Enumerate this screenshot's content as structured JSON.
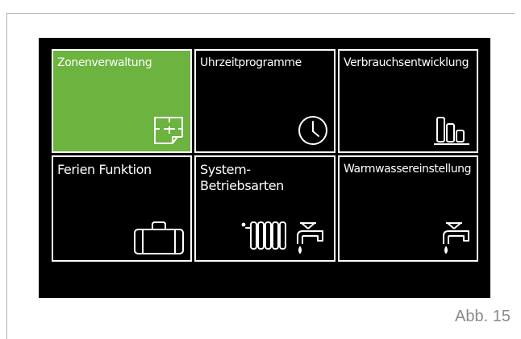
{
  "tiles": [
    {
      "label": "Zonenverwaltung",
      "icon": "floor-plan-icon",
      "selected": true
    },
    {
      "label": "Uhrzeitprogramme",
      "icon": "clock-icon",
      "selected": false
    },
    {
      "label": "Verbrauchsentwicklung",
      "icon": "bar-chart-icon",
      "selected": false
    },
    {
      "label": "Ferien Funktion",
      "icon": "suitcase-icon",
      "selected": false
    },
    {
      "label": "System-\nBetriebsarten",
      "label_line1": "System-",
      "label_line2": "Betriebsarten",
      "icons": [
        "radiator-icon",
        "faucet-icon"
      ],
      "selected": false
    },
    {
      "label": "Warmwassereinstellung",
      "icon": "faucet-icon",
      "selected": false
    }
  ],
  "caption": "Abb. 15",
  "colors": {
    "screen_background": "#000000",
    "selected_tile": "#6cb33f",
    "tile_border": "#ffffff",
    "caption_text": "#8a8a8a"
  }
}
